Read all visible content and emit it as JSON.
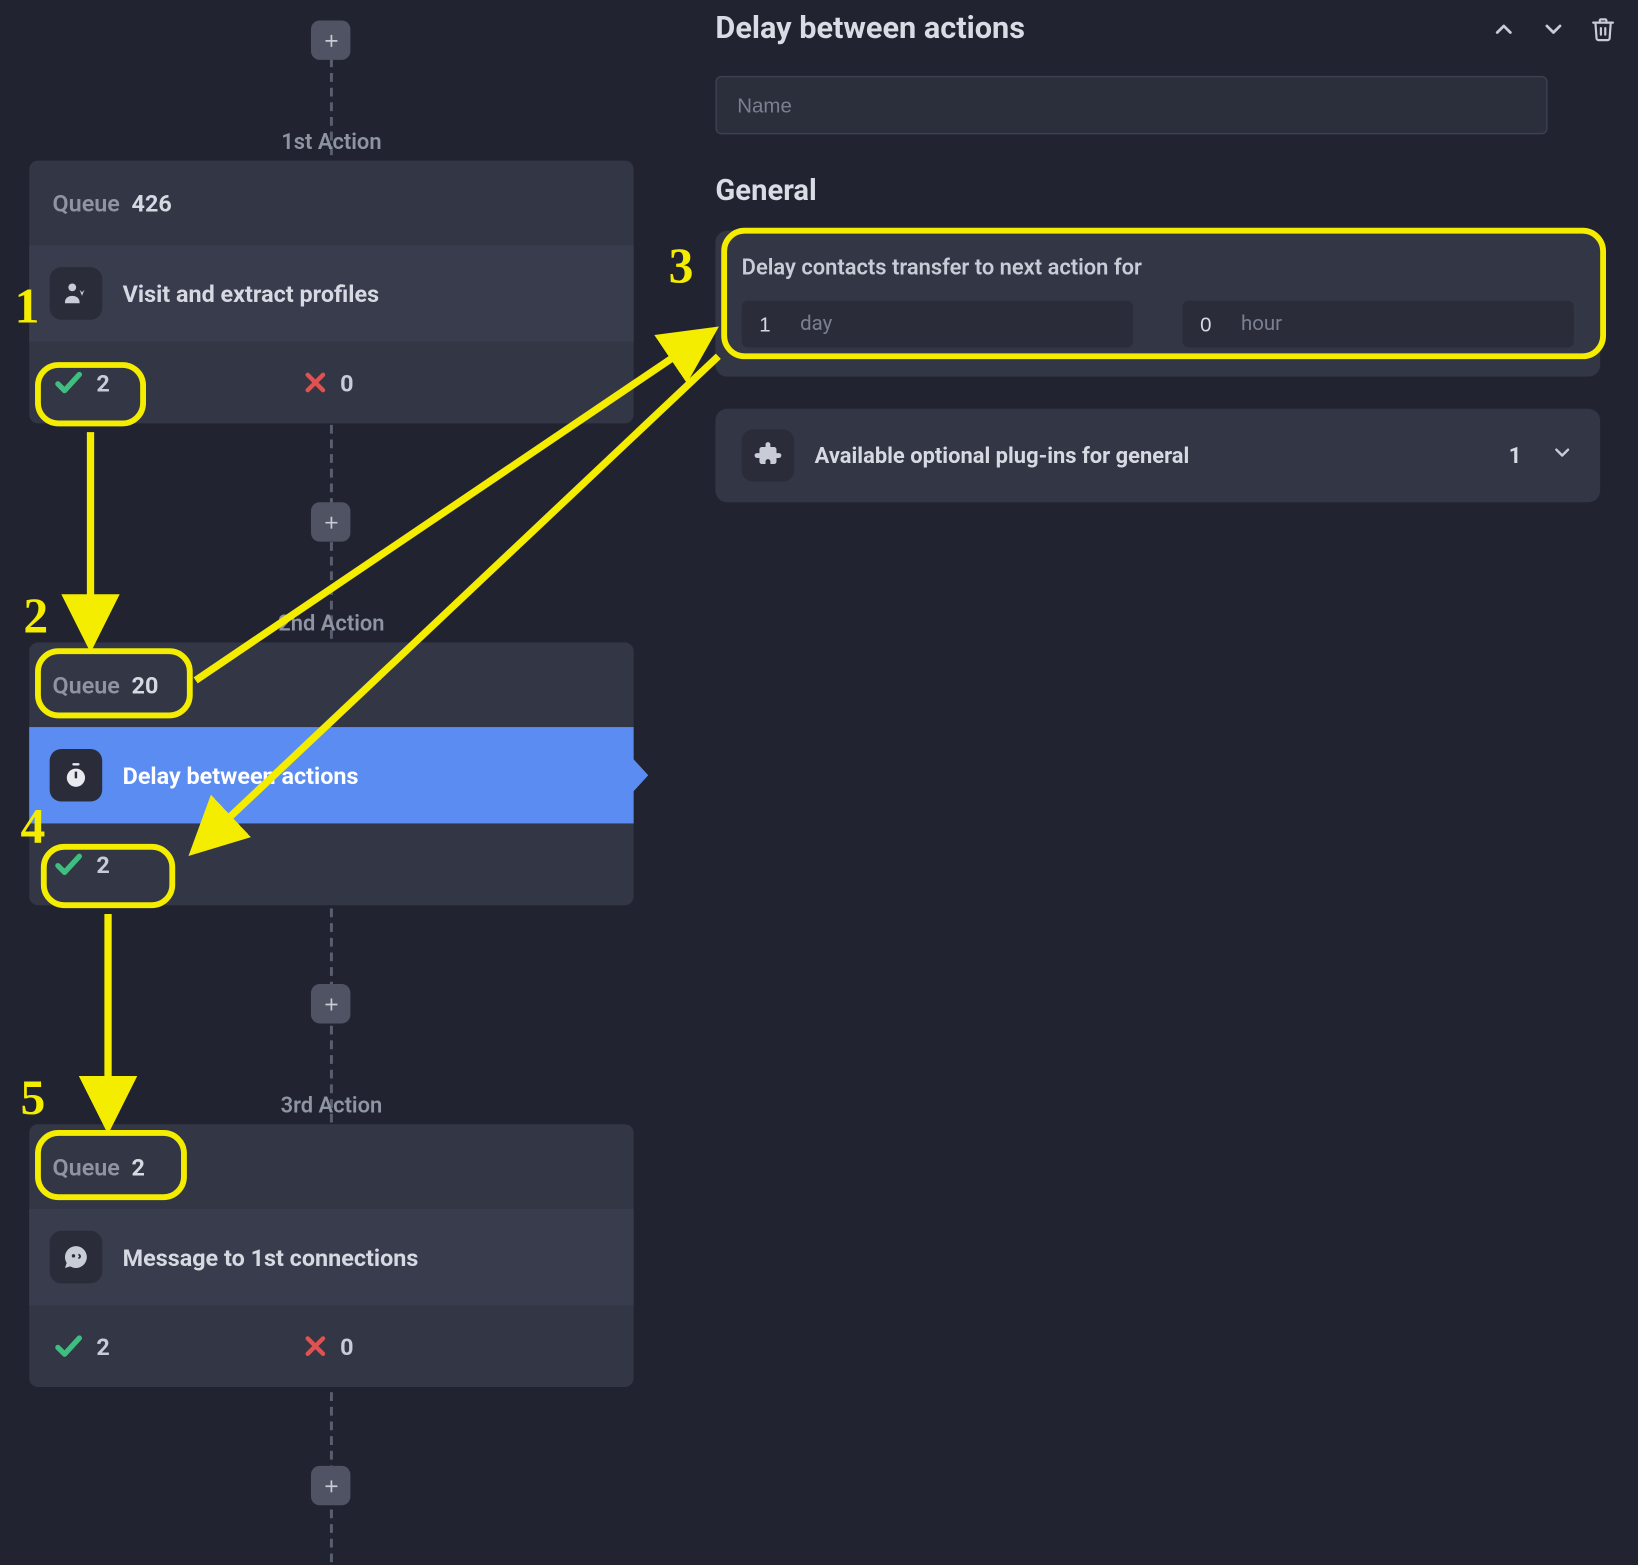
{
  "actions": [
    {
      "label": "1st Action",
      "queue_label": "Queue",
      "queue_count": "426",
      "title": "Visit and extract profiles",
      "success": "2",
      "fail": "0",
      "selected": false,
      "has_fail": true,
      "icon": "user-download"
    },
    {
      "label": "2nd Action",
      "queue_label": "Queue",
      "queue_count": "20",
      "title": "Delay between actions",
      "success": "2",
      "fail": "",
      "selected": true,
      "has_fail": false,
      "icon": "stopwatch"
    },
    {
      "label": "3rd Action",
      "queue_label": "Queue",
      "queue_count": "2",
      "title": "Message to 1st connections",
      "success": "2",
      "fail": "0",
      "selected": false,
      "has_fail": true,
      "icon": "message"
    }
  ],
  "panel": {
    "title": "Delay between actions",
    "name_placeholder": "Name",
    "name_value": "",
    "section_general": "General",
    "delay_label": "Delay contacts transfer to next action for",
    "day_value": "1",
    "day_unit": "day",
    "hour_value": "0",
    "hour_unit": "hour",
    "plugins_text": "Available optional plug-ins for general",
    "plugins_count": "1"
  },
  "annotations": {
    "n1": "1",
    "n2": "2",
    "n3": "3",
    "n4": "4",
    "n5": "5"
  }
}
